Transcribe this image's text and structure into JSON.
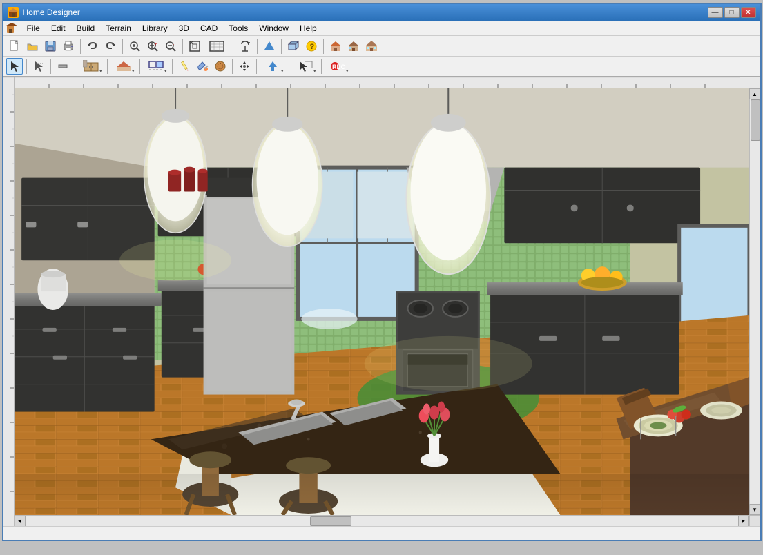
{
  "window": {
    "title": "Home Designer",
    "icon": "HD"
  },
  "title_buttons": {
    "minimize": "—",
    "maximize": "□",
    "close": "✕"
  },
  "menu": {
    "items": [
      {
        "label": "File",
        "id": "file"
      },
      {
        "label": "Edit",
        "id": "edit"
      },
      {
        "label": "Build",
        "id": "build"
      },
      {
        "label": "Terrain",
        "id": "terrain"
      },
      {
        "label": "Library",
        "id": "library"
      },
      {
        "label": "3D",
        "id": "3d"
      },
      {
        "label": "CAD",
        "id": "cad"
      },
      {
        "label": "Tools",
        "id": "tools"
      },
      {
        "label": "Window",
        "id": "window"
      },
      {
        "label": "Help",
        "id": "help"
      }
    ]
  },
  "toolbar1": {
    "buttons": [
      {
        "id": "new",
        "icon": "📄",
        "title": "New"
      },
      {
        "id": "open",
        "icon": "📂",
        "title": "Open"
      },
      {
        "id": "save",
        "icon": "💾",
        "title": "Save"
      },
      {
        "id": "print",
        "icon": "🖨",
        "title": "Print"
      },
      {
        "id": "sep1",
        "type": "sep"
      },
      {
        "id": "undo",
        "icon": "↩",
        "title": "Undo"
      },
      {
        "id": "redo",
        "icon": "↪",
        "title": "Redo"
      },
      {
        "id": "sep2",
        "type": "sep"
      },
      {
        "id": "zoom-in",
        "icon": "🔍",
        "title": "Zoom In"
      },
      {
        "id": "zoom-in2",
        "icon": "⊕",
        "title": "Zoom In Tool"
      },
      {
        "id": "zoom-out",
        "icon": "⊖",
        "title": "Zoom Out"
      },
      {
        "id": "sep3",
        "type": "sep"
      },
      {
        "id": "fit",
        "icon": "⊞",
        "title": "Fit to View"
      },
      {
        "id": "fit2",
        "icon": "▣",
        "title": "Fit Window"
      },
      {
        "id": "sep4",
        "type": "sep"
      },
      {
        "id": "view",
        "icon": "◫",
        "title": "View"
      },
      {
        "id": "sep5",
        "type": "sep"
      },
      {
        "id": "arrow-up",
        "icon": "↑",
        "title": "Up"
      },
      {
        "id": "sep6",
        "type": "sep"
      },
      {
        "id": "3dobj",
        "icon": "🏠",
        "title": "3D Object"
      },
      {
        "id": "help",
        "icon": "?",
        "title": "Help"
      },
      {
        "id": "sep7",
        "type": "sep"
      },
      {
        "id": "house1",
        "icon": "🏠",
        "title": "House 1"
      },
      {
        "id": "house2",
        "icon": "🏡",
        "title": "House 2"
      },
      {
        "id": "house3",
        "icon": "🏘",
        "title": "House 3"
      }
    ]
  },
  "toolbar2": {
    "buttons": [
      {
        "id": "select",
        "icon": "↖",
        "title": "Select Objects"
      },
      {
        "id": "sep1",
        "type": "sep"
      },
      {
        "id": "draw1",
        "icon": "⌐",
        "title": "Draw"
      },
      {
        "id": "sep2",
        "type": "sep"
      },
      {
        "id": "measure",
        "icon": "⊢",
        "title": "Measure"
      },
      {
        "id": "sep3",
        "type": "sep"
      },
      {
        "id": "cabinet",
        "icon": "▦",
        "title": "Cabinet"
      },
      {
        "id": "sep4",
        "type": "sep"
      },
      {
        "id": "roof",
        "icon": "⌂",
        "title": "Roof"
      },
      {
        "id": "sep5",
        "type": "sep"
      },
      {
        "id": "snap",
        "icon": "◈",
        "title": "Snap"
      },
      {
        "id": "sep6",
        "type": "sep"
      },
      {
        "id": "pencil",
        "icon": "✏",
        "title": "Pencil"
      },
      {
        "id": "paint",
        "icon": "🖌",
        "title": "Paint"
      },
      {
        "id": "texture",
        "icon": "◉",
        "title": "Texture"
      },
      {
        "id": "sep7",
        "type": "sep"
      },
      {
        "id": "move",
        "icon": "✥",
        "title": "Move"
      },
      {
        "id": "sep8",
        "type": "sep"
      },
      {
        "id": "arrow-tool",
        "icon": "↑",
        "title": "Arrow"
      },
      {
        "id": "sep9",
        "type": "sep"
      },
      {
        "id": "select2",
        "icon": "⊹",
        "title": "Select 2"
      },
      {
        "id": "sep10",
        "type": "sep"
      },
      {
        "id": "record",
        "icon": "⏺",
        "title": "Record"
      }
    ]
  },
  "scene": {
    "description": "3D Kitchen interior view with dark cabinets, green tile backsplash, kitchen island with sink, pendant lights, hardwood floor",
    "background_color": "#c8c8b0"
  },
  "scrollbar": {
    "h_thumb_position": "40%",
    "v_thumb_position": "0"
  }
}
